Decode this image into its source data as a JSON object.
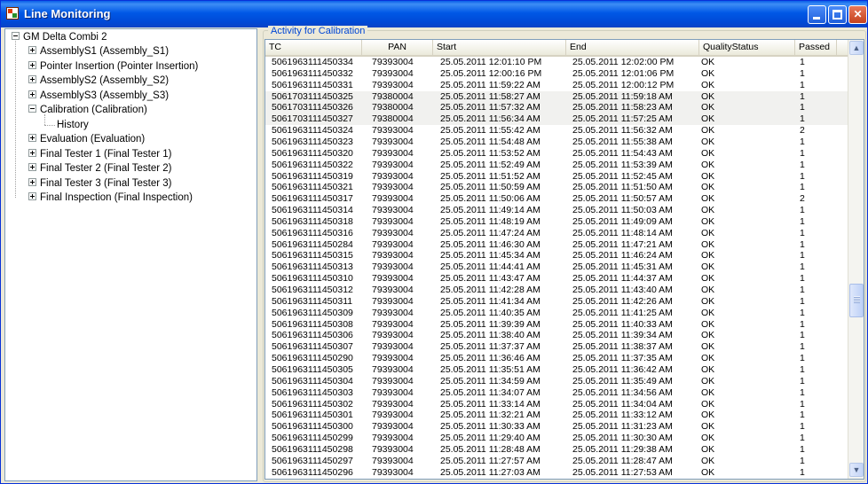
{
  "window": {
    "title": "Line Monitoring"
  },
  "tree": {
    "root": "GM Delta Combi 2",
    "items": [
      {
        "label": "AssemblyS1 (Assembly_S1)",
        "expanded": false
      },
      {
        "label": "Pointer Insertion (Pointer Insertion)",
        "expanded": false
      },
      {
        "label": "AssemblyS2 (Assembly_S2)",
        "expanded": false
      },
      {
        "label": "AssemblyS3 (Assembly_S3)",
        "expanded": false
      },
      {
        "label": "Calibration (Calibration)",
        "expanded": true
      },
      {
        "label": "History",
        "child": true
      },
      {
        "label": "Evaluation (Evaluation)",
        "expanded": false
      },
      {
        "label": "Final Tester 1 (Final Tester 1)",
        "expanded": false
      },
      {
        "label": "Final Tester 2 (Final Tester 2)",
        "expanded": false
      },
      {
        "label": "Final Tester 3 (Final Tester 3)",
        "expanded": false
      },
      {
        "label": "Final Inspection (Final Inspection)",
        "expanded": false
      }
    ]
  },
  "panel": {
    "title": "Activity for Calibration"
  },
  "table": {
    "columns": [
      "TC",
      "PAN",
      "Start",
      "End",
      "QualityStatus",
      "Passed"
    ],
    "rows": [
      [
        "5061963111450334",
        "79393004",
        "25.05.2011 12:01:10 PM",
        "25.05.2011 12:02:00 PM",
        "OK",
        "1"
      ],
      [
        "5061963111450332",
        "79393004",
        "25.05.2011 12:00:16 PM",
        "25.05.2011 12:01:06 PM",
        "OK",
        "1"
      ],
      [
        "5061963111450331",
        "79393004",
        "25.05.2011 11:59:22 AM",
        "25.05.2011 12:00:12 PM",
        "OK",
        "1"
      ],
      [
        "5061703111450325",
        "79380004",
        "25.05.2011 11:58:27 AM",
        "25.05.2011 11:59:18 AM",
        "OK",
        "1"
      ],
      [
        "5061703111450326",
        "79380004",
        "25.05.2011 11:57:32 AM",
        "25.05.2011 11:58:23 AM",
        "OK",
        "1"
      ],
      [
        "5061703111450327",
        "79380004",
        "25.05.2011 11:56:34 AM",
        "25.05.2011 11:57:25 AM",
        "OK",
        "1"
      ],
      [
        "5061963111450324",
        "79393004",
        "25.05.2011 11:55:42 AM",
        "25.05.2011 11:56:32 AM",
        "OK",
        "2"
      ],
      [
        "5061963111450323",
        "79393004",
        "25.05.2011 11:54:48 AM",
        "25.05.2011 11:55:38 AM",
        "OK",
        "1"
      ],
      [
        "5061963111450320",
        "79393004",
        "25.05.2011 11:53:52 AM",
        "25.05.2011 11:54:43 AM",
        "OK",
        "1"
      ],
      [
        "5061963111450322",
        "79393004",
        "25.05.2011 11:52:49 AM",
        "25.05.2011 11:53:39 AM",
        "OK",
        "1"
      ],
      [
        "5061963111450319",
        "79393004",
        "25.05.2011 11:51:52 AM",
        "25.05.2011 11:52:45 AM",
        "OK",
        "1"
      ],
      [
        "5061963111450321",
        "79393004",
        "25.05.2011 11:50:59 AM",
        "25.05.2011 11:51:50 AM",
        "OK",
        "1"
      ],
      [
        "5061963111450317",
        "79393004",
        "25.05.2011 11:50:06 AM",
        "25.05.2011 11:50:57 AM",
        "OK",
        "2"
      ],
      [
        "5061963111450314",
        "79393004",
        "25.05.2011 11:49:14 AM",
        "25.05.2011 11:50:03 AM",
        "OK",
        "1"
      ],
      [
        "5061963111450318",
        "79393004",
        "25.05.2011 11:48:19 AM",
        "25.05.2011 11:49:09 AM",
        "OK",
        "1"
      ],
      [
        "5061963111450316",
        "79393004",
        "25.05.2011 11:47:24 AM",
        "25.05.2011 11:48:14 AM",
        "OK",
        "1"
      ],
      [
        "5061963111450284",
        "79393004",
        "25.05.2011 11:46:30 AM",
        "25.05.2011 11:47:21 AM",
        "OK",
        "1"
      ],
      [
        "5061963111450315",
        "79393004",
        "25.05.2011 11:45:34 AM",
        "25.05.2011 11:46:24 AM",
        "OK",
        "1"
      ],
      [
        "5061963111450313",
        "79393004",
        "25.05.2011 11:44:41 AM",
        "25.05.2011 11:45:31 AM",
        "OK",
        "1"
      ],
      [
        "5061963111450310",
        "79393004",
        "25.05.2011 11:43:47 AM",
        "25.05.2011 11:44:37 AM",
        "OK",
        "1"
      ],
      [
        "5061963111450312",
        "79393004",
        "25.05.2011 11:42:28 AM",
        "25.05.2011 11:43:40 AM",
        "OK",
        "1"
      ],
      [
        "5061963111450311",
        "79393004",
        "25.05.2011 11:41:34 AM",
        "25.05.2011 11:42:26 AM",
        "OK",
        "1"
      ],
      [
        "5061963111450309",
        "79393004",
        "25.05.2011 11:40:35 AM",
        "25.05.2011 11:41:25 AM",
        "OK",
        "1"
      ],
      [
        "5061963111450308",
        "79393004",
        "25.05.2011 11:39:39 AM",
        "25.05.2011 11:40:33 AM",
        "OK",
        "1"
      ],
      [
        "5061963111450306",
        "79393004",
        "25.05.2011 11:38:40 AM",
        "25.05.2011 11:39:34 AM",
        "OK",
        "1"
      ],
      [
        "5061963111450307",
        "79393004",
        "25.05.2011 11:37:37 AM",
        "25.05.2011 11:38:37 AM",
        "OK",
        "1"
      ],
      [
        "5061963111450290",
        "79393004",
        "25.05.2011 11:36:46 AM",
        "25.05.2011 11:37:35 AM",
        "OK",
        "1"
      ],
      [
        "5061963111450305",
        "79393004",
        "25.05.2011 11:35:51 AM",
        "25.05.2011 11:36:42 AM",
        "OK",
        "1"
      ],
      [
        "5061963111450304",
        "79393004",
        "25.05.2011 11:34:59 AM",
        "25.05.2011 11:35:49 AM",
        "OK",
        "1"
      ],
      [
        "5061963111450303",
        "79393004",
        "25.05.2011 11:34:07 AM",
        "25.05.2011 11:34:56 AM",
        "OK",
        "1"
      ],
      [
        "5061963111450302",
        "79393004",
        "25.05.2011 11:33:14 AM",
        "25.05.2011 11:34:04 AM",
        "OK",
        "1"
      ],
      [
        "5061963111450301",
        "79393004",
        "25.05.2011 11:32:21 AM",
        "25.05.2011 11:33:12 AM",
        "OK",
        "1"
      ],
      [
        "5061963111450300",
        "79393004",
        "25.05.2011 11:30:33 AM",
        "25.05.2011 11:31:23 AM",
        "OK",
        "1"
      ],
      [
        "5061963111450299",
        "79393004",
        "25.05.2011 11:29:40 AM",
        "25.05.2011 11:30:30 AM",
        "OK",
        "1"
      ],
      [
        "5061963111450298",
        "79393004",
        "25.05.2011 11:28:48 AM",
        "25.05.2011 11:29:38 AM",
        "OK",
        "1"
      ],
      [
        "5061963111450297",
        "79393004",
        "25.05.2011 11:27:57 AM",
        "25.05.2011 11:28:47 AM",
        "OK",
        "1"
      ],
      [
        "5061963111450296",
        "79393004",
        "25.05.2011 11:27:03 AM",
        "25.05.2011 11:27:53 AM",
        "OK",
        "1"
      ]
    ]
  }
}
